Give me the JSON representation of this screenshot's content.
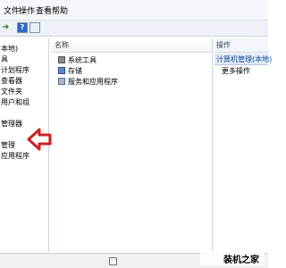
{
  "menu": {
    "items": [
      "文件",
      "操作",
      "查看",
      "帮助"
    ]
  },
  "tree": {
    "root": "本地)",
    "items": [
      "具",
      "计划程序",
      "查看器",
      "文件夹",
      "用户和组",
      "",
      "管理器",
      "",
      "管理",
      "应用程序"
    ]
  },
  "main": {
    "header": "名称",
    "rows": [
      {
        "label": "系统工具"
      },
      {
        "label": "存储"
      },
      {
        "label": "服务和应用程序"
      }
    ]
  },
  "actions": {
    "header": "操作",
    "selected": "计算机管理(本地)",
    "more": "更多操作"
  },
  "watermark": {
    "text": "装机之家"
  },
  "colors": {
    "arrow": "#cf2020",
    "accent": "#1b4d8f"
  }
}
